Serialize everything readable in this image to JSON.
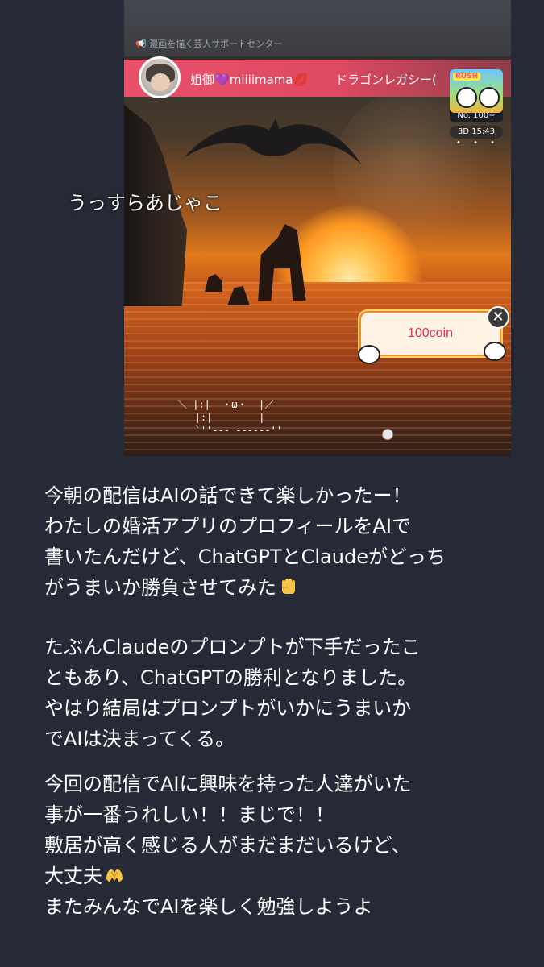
{
  "screenshot": {
    "faded_header_text": "📢 漫画を描く芸人サポートセンター",
    "streamer_name": {
      "prefix": "姐御",
      "heart": "💜",
      "handle": "miiiimama",
      "lips": "💋"
    },
    "game_title": "ドラゴンレガシー(",
    "rank_badge": {
      "thumb_label": "RUSH",
      "rank": "No. 100+",
      "timer": "3D 15:43",
      "dots": "• • •"
    },
    "coin_card": {
      "label": "100coin",
      "close_icon": "✕"
    },
    "ascii_face": "＼ |:|  ・ω・  |／\n   |:|        |\n   `''--- ------''",
    "overlay_caption": "うっすらあじゃこ"
  },
  "paragraphs": [
    {
      "lines": [
        "今朝の配信はAIの話できて楽しかったー！",
        "わたしの婚活アプリのプロフィールをAIで",
        "書いたんだけど、ChatGPTとClaudeがどっち",
        "がうまいか勝負させてみた"
      ]
    },
    {
      "lines": [
        "たぶんClaudeのプロンプトが下手だったこ",
        "ともあり、ChatGPTの勝利となりました。",
        "やはり結局はプロンプトがいかにうまいか",
        "でAIは決まってくる。"
      ]
    },
    {
      "lines": [
        "今回の配信でAIに興味を持った人達がいた",
        "事が一番うれしい！！まじで！！",
        "敷居が高く感じる人がまだまだいるけど、",
        "大丈夫",
        "またみんなでAIを楽しく勉強しようよ"
      ]
    }
  ],
  "icons": {
    "fist": "raised-fist-icon",
    "heart_hands": "heart-hands-icon"
  },
  "colors": {
    "background": "#262a37",
    "live_bar": "#e8506a",
    "coin_text": "#e0334c"
  }
}
